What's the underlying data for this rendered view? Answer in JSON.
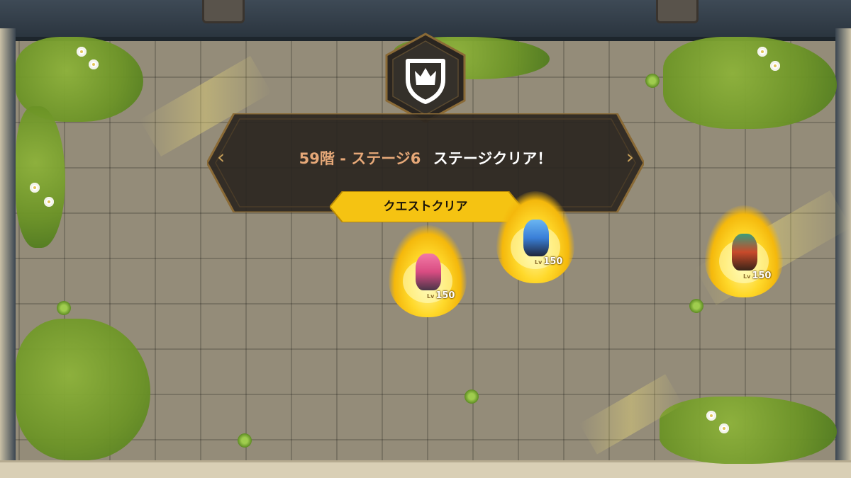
{
  "banner": {
    "stage_name": "59階 - ステージ6",
    "stage_result": "ステージクリア！",
    "left_chevron": "‹",
    "right_chevron": "›",
    "quest_button": "クエストクリア"
  },
  "heroes": [
    {
      "name": "pink-archer",
      "level": "150",
      "level_prefix": "Lv"
    },
    {
      "name": "blue-mage",
      "level": "150",
      "level_prefix": "Lv"
    },
    {
      "name": "green-hat-warrior",
      "level": "150",
      "level_prefix": "Lv"
    }
  ],
  "colors": {
    "banner_bg": "#2a2520",
    "banner_border": "#8a6a36",
    "quest_button": "#f5c312",
    "stage_name": "#e6a878",
    "flame": "#ffd92b"
  },
  "icons": {
    "emblem": "crown-shield-icon"
  }
}
